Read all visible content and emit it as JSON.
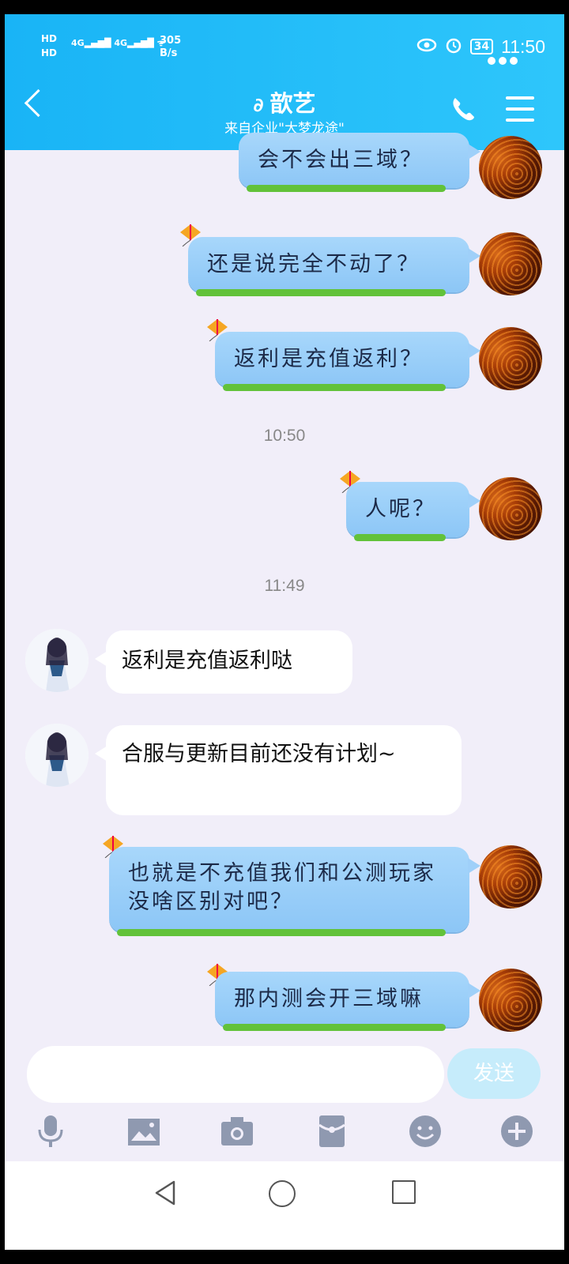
{
  "status_bar": {
    "hd1": "HD",
    "hd2": "HD",
    "signal1": "4G",
    "signal2": "4G",
    "speed_value": "305",
    "speed_unit": "B/s",
    "battery": "34",
    "time": "11:50"
  },
  "header": {
    "title": "歆艺",
    "subtitle": "来自企业\"大梦龙途\""
  },
  "messages": [
    {
      "side": "self",
      "text": "会不会出三域？"
    },
    {
      "side": "self",
      "text": "还是说完全不动了？"
    },
    {
      "side": "self",
      "text": "返利是充值返利？"
    },
    {
      "side": "time",
      "text": "10:50"
    },
    {
      "side": "self",
      "text": "人呢？"
    },
    {
      "side": "time",
      "text": "11:49"
    },
    {
      "side": "other",
      "text": "返利是充值返利哒"
    },
    {
      "side": "other",
      "text": "合服与更新目前还没有计划~"
    },
    {
      "side": "self",
      "text": "也就是不充值我们和公测玩家没啥区别对吧？"
    },
    {
      "side": "self",
      "text": "那内测会开三域嘛"
    }
  ],
  "input": {
    "placeholder": "",
    "send_label": "发送"
  },
  "toolbar": [
    "microphone-icon",
    "image-icon",
    "camera-icon",
    "red-packet-icon",
    "emoji-icon",
    "plus-icon"
  ],
  "colors": {
    "header": "#19b4f6",
    "background": "#f1eef9",
    "self_bubble": "#a8d7fb",
    "send_button": "#c6ecfb"
  }
}
